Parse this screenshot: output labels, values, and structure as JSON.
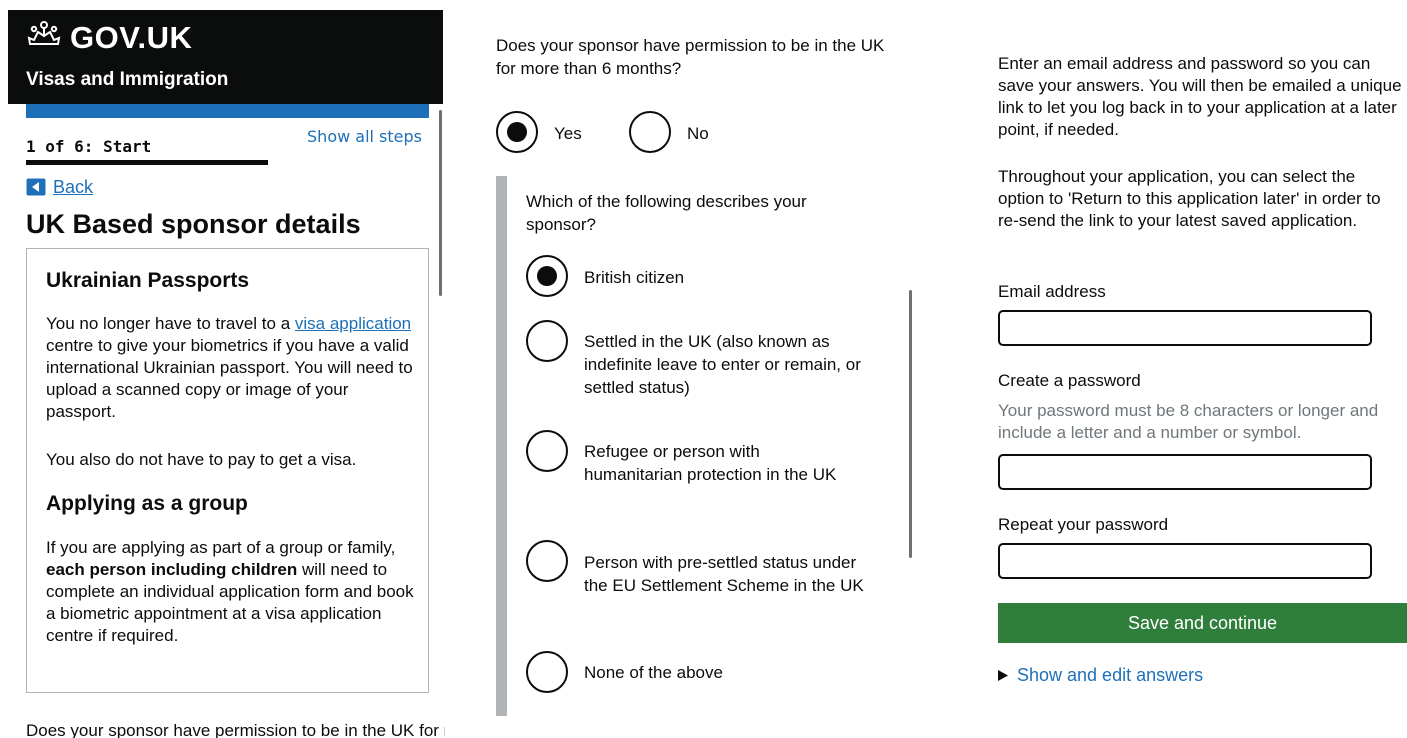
{
  "header": {
    "logo_text": "GOV.UK",
    "service_name": "Visas and Immigration"
  },
  "progress": {
    "step_label": "1 of 6: Start",
    "show_all_steps": "Show all steps",
    "current_step": 1,
    "total_steps": 6
  },
  "nav": {
    "back_label": "Back"
  },
  "page": {
    "title": "UK Based sponsor details"
  },
  "info_box": {
    "heading1": "Ukrainian Passports",
    "p1_before": "You no longer have to travel to a ",
    "p1_link": "visa application",
    "p1_after": " centre to give your biometrics if you have a valid international Ukrainian passport. You will need to upload a scanned copy or image of your passport.",
    "p2": "You also do not have to pay to get a visa.",
    "heading2": "Applying as a group",
    "p3_before": "If you are applying as part of a group or family, ",
    "p3_bold": "each person including children",
    "p3_after": " will need to complete an individual application form and book a biometric appointment at a visa application centre if required."
  },
  "permission_question": {
    "text": "Does your sponsor have permission to be in the UK for more than 6 months?",
    "options": [
      {
        "label": "Yes",
        "checked": true
      },
      {
        "label": "No",
        "checked": false
      }
    ]
  },
  "sponsor_type_question": {
    "text": "Which of the following describes your sponsor?",
    "options": [
      {
        "label": "British citizen",
        "checked": true
      },
      {
        "label": "Settled in the UK (also known as indefinite leave to enter or remain, or settled status)",
        "checked": false
      },
      {
        "label": "Refugee or person with humanitarian protection in the UK",
        "checked": false
      },
      {
        "label": "Person with pre-settled status under the EU Settlement Scheme in the UK",
        "checked": false
      },
      {
        "label": "None of the above",
        "checked": false
      }
    ]
  },
  "save_section": {
    "intro1": "Enter an email address and password so you can save your answers. You will then be emailed a unique link to let you log back in to your application at a later point, if needed.",
    "intro2": "Throughout your application, you can select the option to 'Return to this application later' in order to re-send the link to your latest saved application.",
    "email_label": "Email address",
    "email_value": "",
    "password_label": "Create a password",
    "password_hint": "Your password must be 8 characters or longer and include a letter and a number or symbol.",
    "password_value": "",
    "repeat_label": "Repeat your password",
    "repeat_value": "",
    "submit_label": "Save and continue",
    "details_summary": "Show and edit answers"
  },
  "colors": {
    "header_bg": "#0b0c0c",
    "brand_blue": "#1d70b8",
    "link": "#1d70b8",
    "button_green": "#2f7e3b",
    "border_grey": "#b1b4b6",
    "hint_grey": "#6f777b",
    "text": "#0b0c0c"
  },
  "icons": {
    "crown": "crown-icon",
    "back": "back-arrow-icon",
    "details": "triangle-right-icon"
  }
}
